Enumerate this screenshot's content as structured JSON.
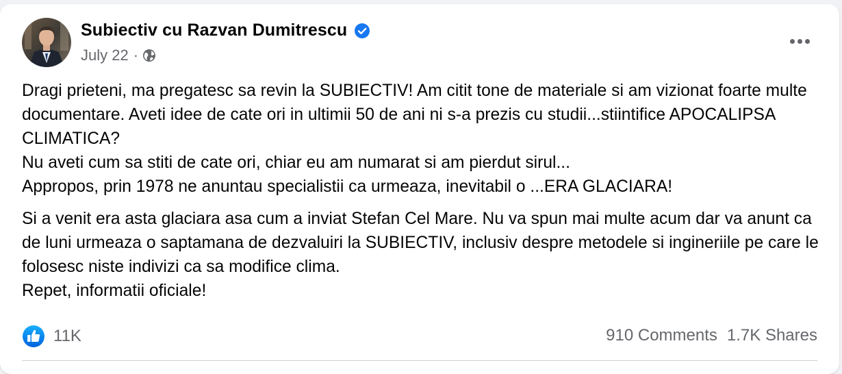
{
  "post": {
    "author": "Subiectiv cu Razvan Dumitrescu",
    "verified": true,
    "date": "July 22",
    "separator": "·",
    "audience_icon": "globe-icon",
    "more_icon": "more-options-icon",
    "body": {
      "paragraph1": [
        "Dragi prieteni, ma pregatesc sa revin la SUBIECTIV! Am citit tone de materiale si am vizionat foarte multe documentare. Aveti idee de cate ori in ultimii 50 de ani ni s-a prezis cu studii...stiintifice APOCALIPSA CLIMATICA?",
        "Nu aveti cum sa stiti de cate ori, chiar eu am numarat si am pierdut sirul...",
        "Appropos, prin 1978 ne anuntau specialistii ca urmeaza, inevitabil o ...ERA GLACIARA!"
      ],
      "paragraph2": [
        "Si a venit era asta glaciara asa cum a inviat Stefan Cel Mare. Nu va spun mai multe acum dar va anunt ca de luni urmeaza o saptamana de dezvaluiri la SUBIECTIV, inclusiv despre metodele si ingineriile pe care le folosesc niste indivizi ca sa modifice clima.",
        "Repet, informatii oficiale!"
      ]
    },
    "reactions": {
      "icon": "like-icon",
      "count": "11K"
    },
    "comments": "910 Comments",
    "shares": "1.7K Shares"
  },
  "colors": {
    "text_primary": "#050505",
    "text_secondary": "#65676b",
    "facebook_blue": "#1877f2",
    "background": "#f0f2f5",
    "card": "#ffffff"
  }
}
